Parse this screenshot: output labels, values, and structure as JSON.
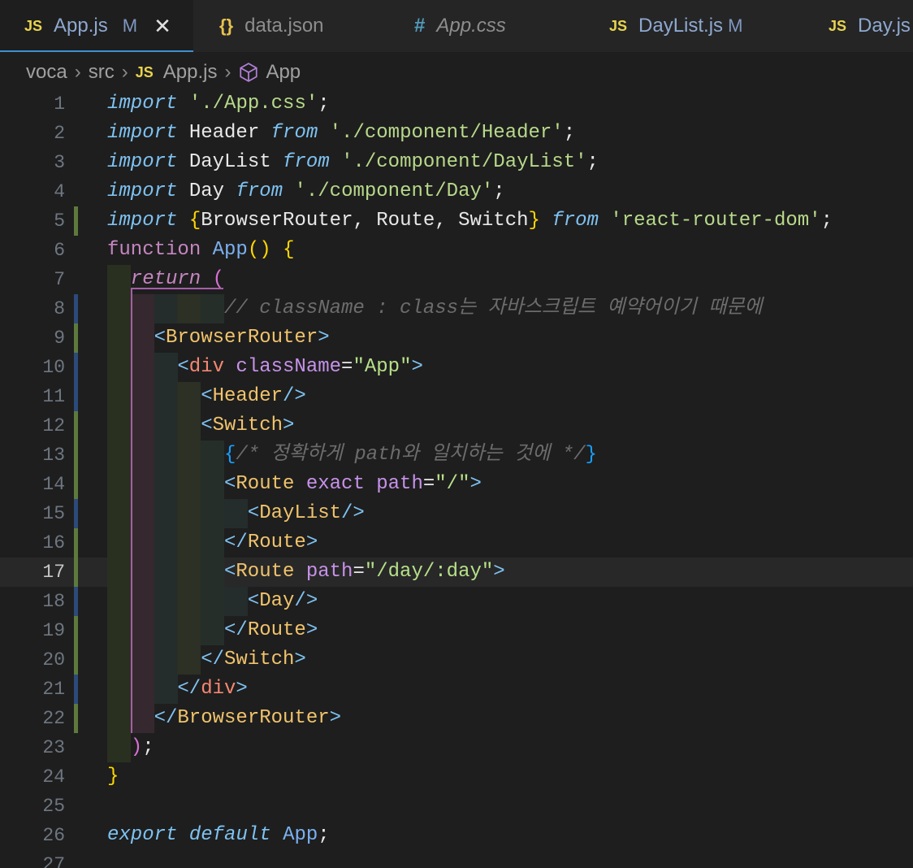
{
  "tabs": [
    {
      "icon": "JS",
      "label": "App.js",
      "flag": "M",
      "active": true
    },
    {
      "icon": "{}",
      "label": "data.json"
    },
    {
      "icon": "#",
      "label": "App.css"
    },
    {
      "icon": "JS",
      "label": "DayList.js",
      "flag": "M"
    },
    {
      "icon": "JS",
      "label": "Day.js"
    }
  ],
  "breadcrumb": {
    "parts": [
      "voca",
      "src"
    ],
    "file_icon": "JS",
    "file": "App.js",
    "symbol": "App"
  },
  "current_line": 17,
  "lines": [
    {
      "n": "1"
    },
    {
      "n": "2"
    },
    {
      "n": "3"
    },
    {
      "n": "4"
    },
    {
      "n": "5"
    },
    {
      "n": "6"
    },
    {
      "n": "7"
    },
    {
      "n": "8"
    },
    {
      "n": "9"
    },
    {
      "n": "10"
    },
    {
      "n": "11"
    },
    {
      "n": "12"
    },
    {
      "n": "13"
    },
    {
      "n": "14"
    },
    {
      "n": "15"
    },
    {
      "n": "16"
    },
    {
      "n": "17"
    },
    {
      "n": "18"
    },
    {
      "n": "19"
    },
    {
      "n": "20"
    },
    {
      "n": "21"
    },
    {
      "n": "22"
    },
    {
      "n": "23"
    },
    {
      "n": "24"
    },
    {
      "n": "25"
    },
    {
      "n": "26"
    },
    {
      "n": "27"
    }
  ],
  "code": {
    "l1": {
      "a": "import",
      "b": " ",
      "c": "'./App.css'",
      "d": ";"
    },
    "l2": {
      "a": "import",
      "b": " Header ",
      "c": "from",
      "d": " ",
      "e": "'./component/Header'",
      "f": ";"
    },
    "l3": {
      "a": "import",
      "b": " DayList ",
      "c": "from",
      "d": " ",
      "e": "'./component/DayList'",
      "f": ";"
    },
    "l4": {
      "a": "import",
      "b": " Day ",
      "c": "from",
      "d": " ",
      "e": "'./component/Day'",
      "f": ";"
    },
    "l5": {
      "a": "import",
      "b": " ",
      "c": "{",
      "d": "BrowserRouter, Route, Switch",
      "e": "}",
      "f": " ",
      "g": "from",
      "h": " ",
      "i": "'react-router-dom'",
      "j": ";"
    },
    "l6": {
      "a": "function",
      "b": " ",
      "c": "App",
      "d": "()",
      "e": " ",
      "f": "{"
    },
    "l7": {
      "a": "return",
      "b": " ",
      "c": "("
    },
    "l8": {
      "a": "// className : class는 자바스크립트 예약어이기 때문에"
    },
    "l9": {
      "a": "<",
      "b": "BrowserRouter",
      "c": ">"
    },
    "l10": {
      "a": "<",
      "b": "div",
      "c": " ",
      "d": "className",
      "e": "=",
      "f": "\"App\"",
      "g": ">"
    },
    "l11": {
      "a": "<",
      "b": "Header",
      "c": "/>"
    },
    "l12": {
      "a": "<",
      "b": "Switch",
      "c": ">"
    },
    "l13": {
      "a": "{",
      "b": "/* 정확하게 path와 일치하는 것에 */",
      "c": "}"
    },
    "l14": {
      "a": "<",
      "b": "Route",
      "c": " ",
      "d": "exact",
      "e": " ",
      "f": "path",
      "g": "=",
      "h": "\"/\"",
      "i": ">"
    },
    "l15": {
      "a": "<",
      "b": "DayList",
      "c": "/>"
    },
    "l16": {
      "a": "</",
      "b": "Route",
      "c": ">"
    },
    "l17": {
      "a": "<",
      "b": "Route",
      "c": " ",
      "d": "path",
      "e": "=",
      "f": "\"/day/:day\"",
      "g": ">"
    },
    "l18": {
      "a": "<",
      "b": "Day",
      "c": "/>"
    },
    "l19": {
      "a": "</",
      "b": "Route",
      "c": ">"
    },
    "l20": {
      "a": "</",
      "b": "Switch",
      "c": ">"
    },
    "l21": {
      "a": "</",
      "b": "div",
      "c": ">"
    },
    "l22": {
      "a": "</",
      "b": "BrowserRouter",
      "c": ">"
    },
    "l23": {
      "a": ")",
      "b": ";"
    },
    "l24": {
      "a": "}"
    },
    "l26": {
      "a": "export",
      "b": " ",
      "c": "default",
      "d": " ",
      "e": "App",
      "f": ";"
    }
  },
  "colors": {
    "background": "#1e1e1e",
    "tab_bar": "#252526",
    "active_tab_underline": "#3d8fd1",
    "js_icon": "#e8d44d",
    "keyword": "#7ec2f1",
    "string": "#b7d98a",
    "tag": "#f0c36c",
    "comment": "#6c6c6c"
  }
}
